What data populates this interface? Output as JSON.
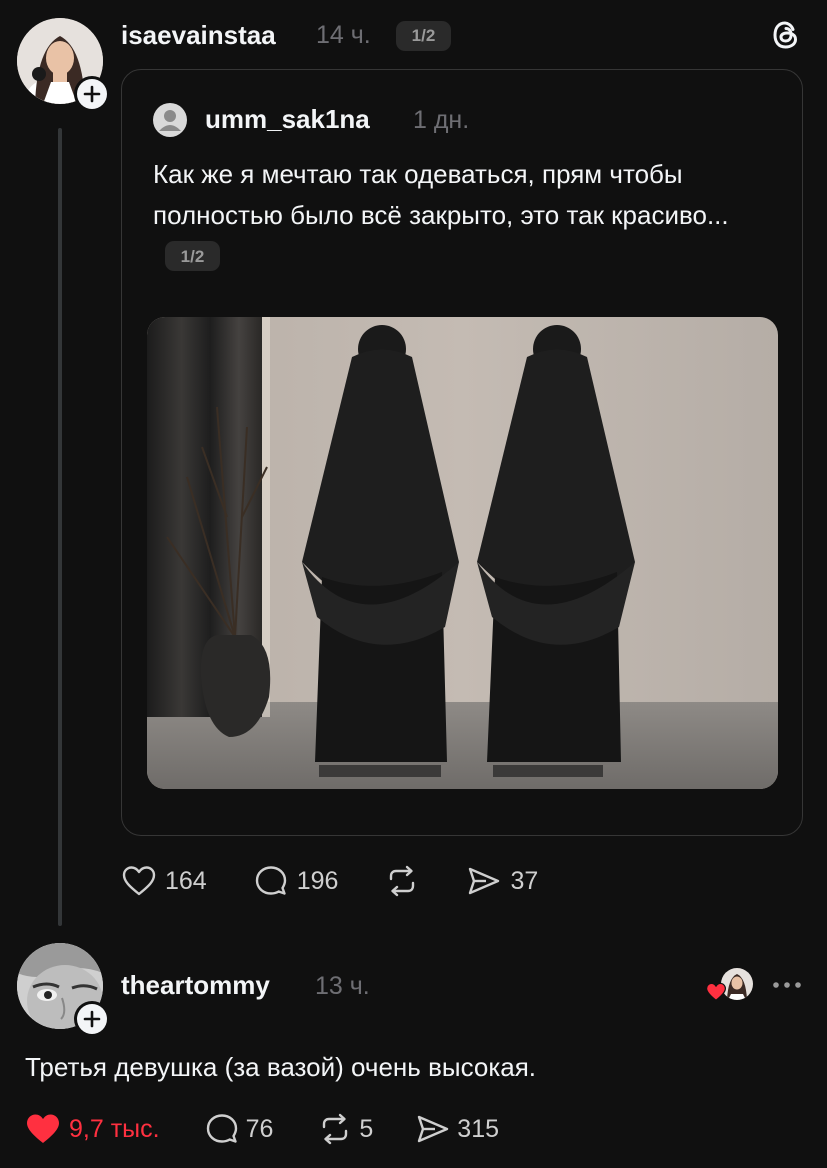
{
  "post": {
    "author": "isaevainstaa",
    "time": "14 ч.",
    "pager": "1/2",
    "quote": {
      "author": "umm_sak1na",
      "time": "1 дн.",
      "text": "Как же я мечтаю так одеваться, прям чтобы полностью было всё закрыто, это так красиво...",
      "pager": "1/2"
    },
    "actions": {
      "likes": "164",
      "replies": "196",
      "reposts": "",
      "shares": "37"
    }
  },
  "reply": {
    "author": "theartommy",
    "time": "13 ч.",
    "text": "Третья девушка (за вазой) очень высокая.",
    "actions": {
      "likes": "9,7 тыс.",
      "replies": "76",
      "reposts": "5",
      "shares": "315"
    }
  },
  "colors": {
    "like_active": "#ff3040",
    "background": "#101010",
    "muted": "#6e6e73"
  },
  "icons": [
    "threads-logo-icon",
    "heart-icon",
    "comment-icon",
    "repost-icon",
    "share-icon",
    "more-icon",
    "plus-icon"
  ]
}
